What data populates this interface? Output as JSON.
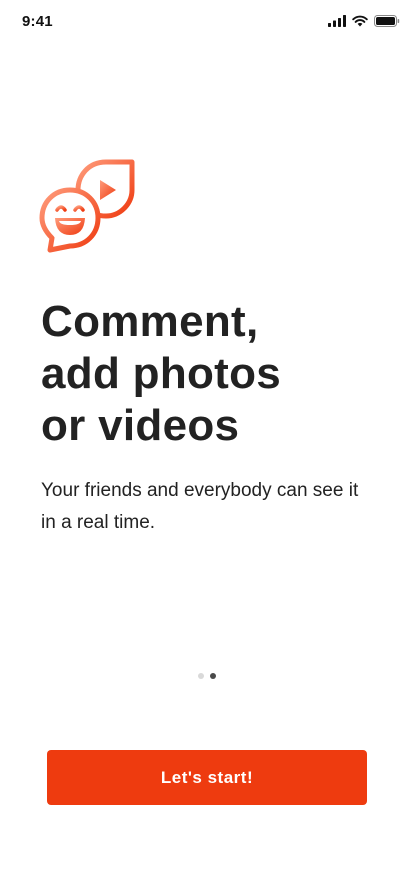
{
  "status_bar": {
    "time": "9:41",
    "icons": [
      "signal-icon",
      "wifi-icon",
      "battery-icon"
    ]
  },
  "illustration": {
    "icons": [
      "smiley-chat-bubble-icon",
      "video-chat-bubble-icon"
    ],
    "colors": {
      "gradient_start": "#ff9a7a",
      "gradient_end": "#ef3b10"
    }
  },
  "onboarding": {
    "title_lines": [
      "Comment,",
      "add photos",
      "or videos"
    ],
    "subtitle": "Your friends and everybody can see it in a real time.",
    "pages": {
      "total": 2,
      "current": 2
    }
  },
  "cta": {
    "label": "Let's start!",
    "color": "#ee3b0f"
  }
}
